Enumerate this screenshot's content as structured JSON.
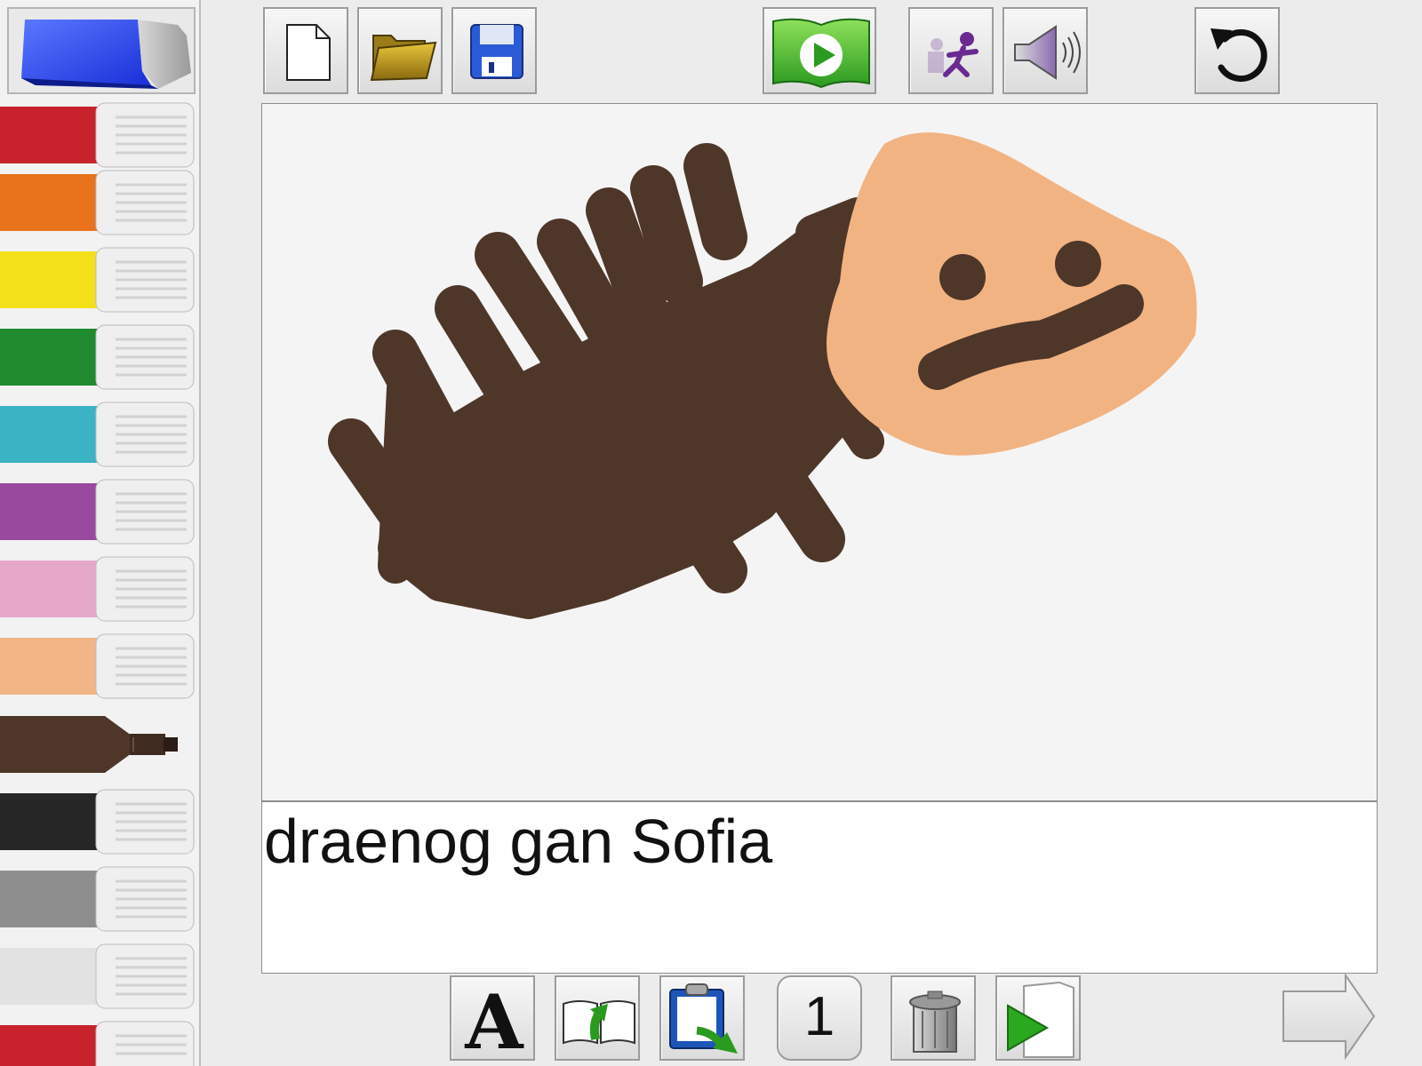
{
  "toolbar": {
    "new_page_icon": "new-document-icon",
    "open_icon": "folder-icon",
    "save_icon": "floppy-disk-icon",
    "play_book_icon": "play-book-icon",
    "animate_icon": "running-figure-icon",
    "sound_icon": "speaker-icon",
    "undo_icon": "undo-icon"
  },
  "palette": {
    "eraser_icon": "eraser-icon",
    "selected_color": "#4e3629",
    "colors": [
      "#c8232c",
      "#e8731c",
      "#f3e01a",
      "#1f8a2e",
      "#3ab3c4",
      "#9a4a9e",
      "#e6a8c8",
      "#f2b585",
      "#4e3629",
      "#262626",
      "#8e8e8e",
      "#e8e8e8",
      "#c8232c"
    ]
  },
  "canvas": {
    "stroke_color_body": "#4e3629",
    "stroke_color_face": "#f2b382"
  },
  "caption": {
    "text": "draenog gan Sofia"
  },
  "bottom_bar": {
    "text_icon": "letter-a-icon",
    "import_icon": "import-image-icon",
    "paste_icon": "clipboard-icon",
    "page_number": "1",
    "delete_icon": "trash-icon",
    "play_page_icon": "play-page-icon",
    "next_icon": "next-arrow-icon"
  }
}
